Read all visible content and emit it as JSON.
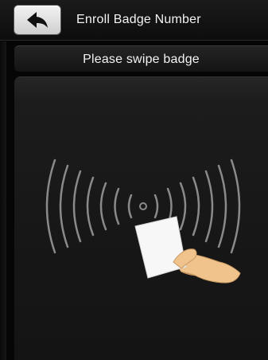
{
  "header": {
    "title": "Enroll Badge Number",
    "back_icon": "back-arrow-icon"
  },
  "prompt": {
    "text": "Please swipe badge"
  },
  "illustration": {
    "icons": [
      "rfid-waves-icon",
      "badge-card-icon",
      "hand-icon"
    ]
  },
  "colors": {
    "background": "#060606",
    "text": "#f3f3f3",
    "waves": "#8a8a8a",
    "hand": "#f2c08a"
  }
}
